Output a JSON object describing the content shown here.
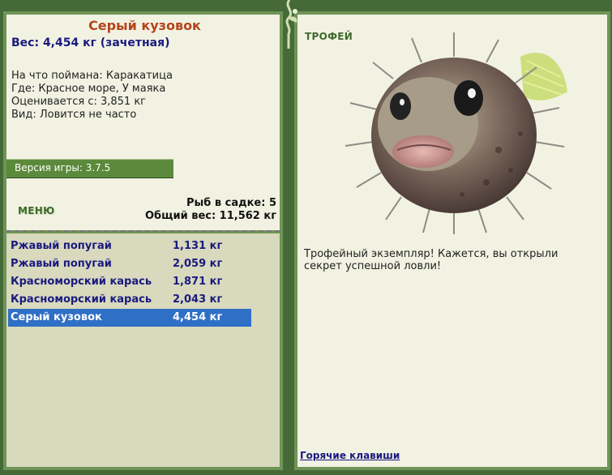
{
  "fish": {
    "name": "Серый кузовок",
    "weight_line": "Вес: 4,454 кг (зачетная)",
    "bait": "На что поймана: Каракатица",
    "place": "Где: Красное море, У маяка",
    "value": "Оценивается с: 3,851 кг",
    "frequency": "Вид: Ловится не часто"
  },
  "version": "Версия игры: 3.7.5",
  "menu_label": "МЕНЮ",
  "stats": {
    "count": "Рыб в садке: 5",
    "total": "Общий вес: 11,562 кг"
  },
  "catch_list": [
    {
      "name": "Ржавый попугай",
      "weight": "1,131 кг"
    },
    {
      "name": "Ржавый попугай",
      "weight": "2,059 кг"
    },
    {
      "name": "Красноморский карась",
      "weight": "1,871 кг"
    },
    {
      "name": "Красноморский карась",
      "weight": "2,043 кг"
    },
    {
      "name": "Серый кузовок",
      "weight": "4,454 кг"
    }
  ],
  "selected_index": 4,
  "trophy": {
    "label": "ТРОФЕЙ",
    "text": "Трофейный экземпляр! Кажется, вы открыли секрет успешной ловли!"
  },
  "hotkeys": "Горячие клавиши",
  "colors": {
    "frame": "#466a37",
    "panel": "#f2f2e3",
    "list_bg": "#d8d9bd",
    "selected": "#2f6fc6",
    "title": "#b5441a",
    "link": "#1a1a80"
  }
}
